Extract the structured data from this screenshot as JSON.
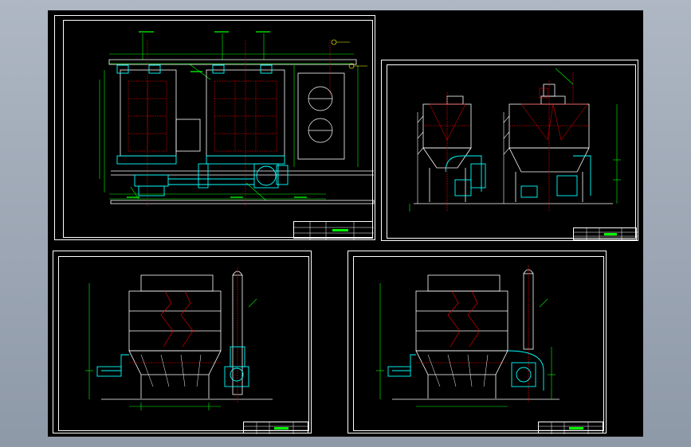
{
  "viewport": {
    "background": "#000000"
  },
  "colors": {
    "frame": "#ffffff",
    "dimension": "#00ff00",
    "outline": "#ffffff",
    "centerline": "#ff0000",
    "equipment": "#00ffff",
    "text": "#00ff00",
    "leader": "#ffff00"
  },
  "sheets": [
    {
      "id": "sheet-1",
      "view": "plan",
      "title_block": {
        "text": ""
      }
    },
    {
      "id": "sheet-2",
      "view": "front-elevation",
      "title_block": {
        "text": ""
      }
    },
    {
      "id": "sheet-3",
      "view": "side-elevation-a",
      "title_block": {
        "text": ""
      }
    },
    {
      "id": "sheet-4",
      "view": "side-elevation-b",
      "title_block": {
        "text": ""
      }
    }
  ]
}
